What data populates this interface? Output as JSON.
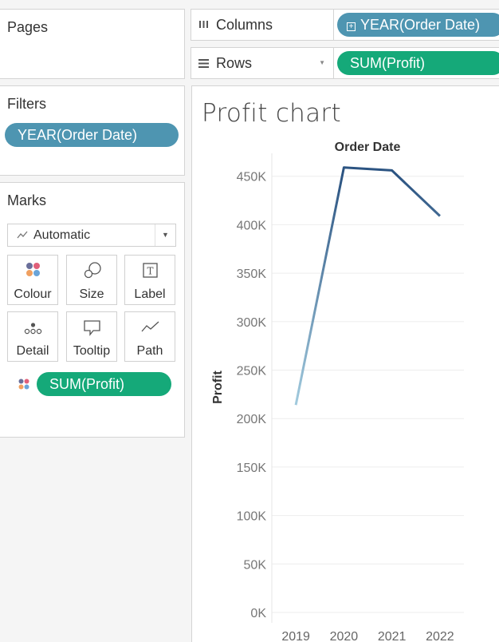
{
  "cards": {
    "pages_title": "Pages",
    "filters_title": "Filters",
    "marks_title": "Marks"
  },
  "filters": {
    "pill": "YEAR(Order Date)"
  },
  "marks": {
    "type_label": "Automatic",
    "buttons": [
      {
        "label": "Colour",
        "icon": "colour-icon"
      },
      {
        "label": "Size",
        "icon": "size-icon"
      },
      {
        "label": "Label",
        "icon": "label-icon"
      },
      {
        "label": "Detail",
        "icon": "detail-icon"
      },
      {
        "label": "Tooltip",
        "icon": "tooltip-icon"
      },
      {
        "label": "Path",
        "icon": "path-icon"
      }
    ],
    "pill": "SUM(Profit)"
  },
  "shelves": {
    "columns_label": "Columns",
    "rows_label": "Rows",
    "columns_pill": "YEAR(Order Date)",
    "rows_pill": "SUM(Profit)"
  },
  "colors": {
    "dimension_pill": "#4e95b1",
    "measure_pill": "#15a979",
    "line_start": "#a7d0e2",
    "line_end": "#2c5482"
  },
  "chart_title": "Profit chart",
  "chart_data": {
    "type": "line",
    "title": "Order Date",
    "xlabel": "",
    "ylabel": "Profit",
    "categories": [
      "2019",
      "2020",
      "2021",
      "2022"
    ],
    "series": [
      {
        "values": [
          214000,
          459000,
          456000,
          409000
        ]
      }
    ],
    "ylim": [
      0,
      480000
    ],
    "yticks": [
      0,
      50000,
      100000,
      150000,
      200000,
      250000,
      300000,
      350000,
      400000,
      450000
    ],
    "ytick_labels": [
      "0K",
      "50K",
      "100K",
      "150K",
      "200K",
      "250K",
      "300K",
      "350K",
      "400K",
      "450K"
    ],
    "grid": true
  }
}
